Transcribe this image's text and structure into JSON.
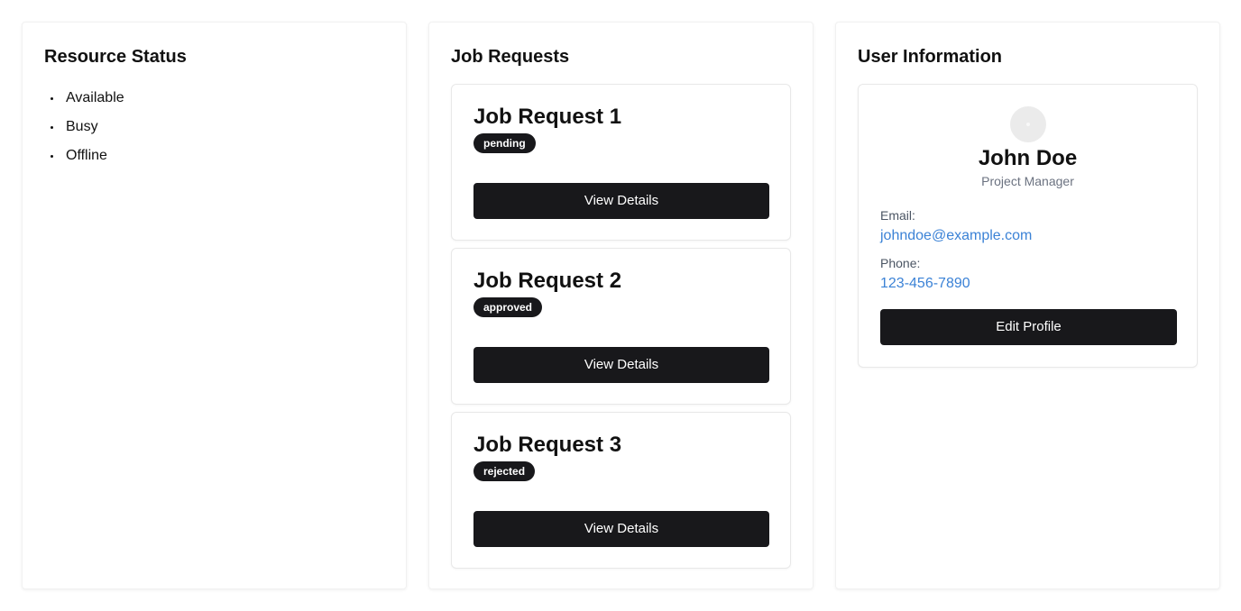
{
  "resource_status": {
    "title": "Resource Status",
    "items": [
      {
        "label": "Available"
      },
      {
        "label": "Busy"
      },
      {
        "label": "Offline"
      }
    ]
  },
  "job_requests": {
    "title": "Job Requests",
    "items": [
      {
        "title": "Job Request 1",
        "status": "pending",
        "button_label": "View Details"
      },
      {
        "title": "Job Request 2",
        "status": "approved",
        "button_label": "View Details"
      },
      {
        "title": "Job Request 3",
        "status": "rejected",
        "button_label": "View Details"
      }
    ]
  },
  "user_info": {
    "title": "User Information",
    "name": "John Doe",
    "role": "Project Manager",
    "email_label": "Email:",
    "email": "johndoe@example.com",
    "phone_label": "Phone:",
    "phone": "123-456-7890",
    "edit_button_label": "Edit Profile"
  },
  "colors": {
    "button_bg": "#18181b",
    "link": "#3b82d6",
    "muted_text": "#6b7280"
  }
}
